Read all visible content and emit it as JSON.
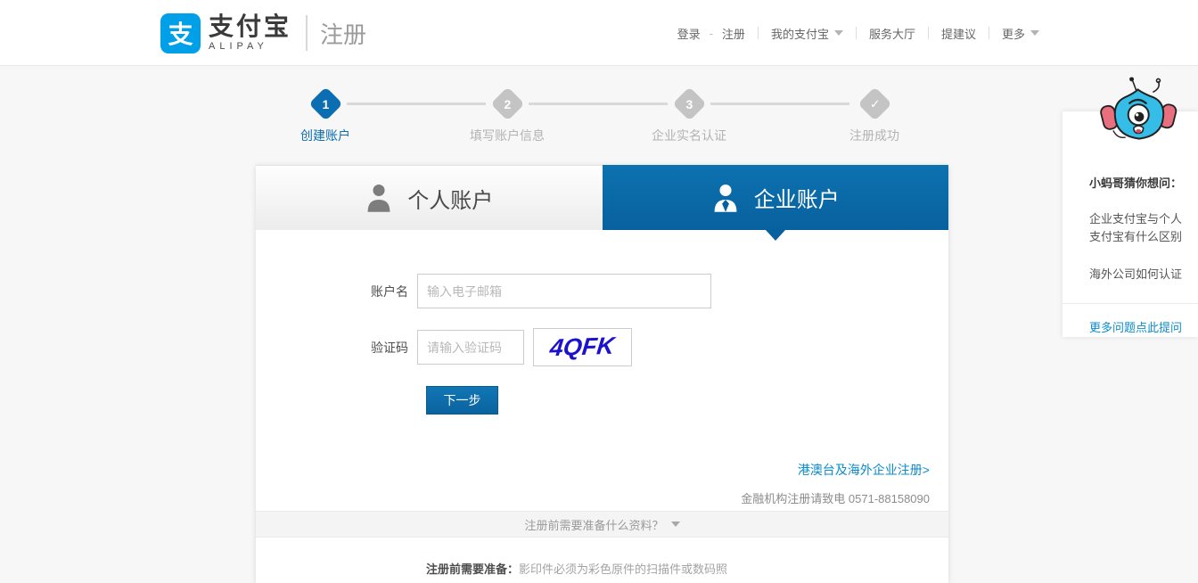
{
  "header": {
    "logo_char": "支",
    "brand_cn": "支付宝",
    "brand_en": "ALIPAY",
    "page_title": "注册",
    "nav_dash": "-",
    "nav": [
      {
        "label": "登录"
      },
      {
        "label": "注册"
      },
      {
        "label": "我的支付宝"
      },
      {
        "label": "服务大厅"
      },
      {
        "label": "提建议"
      },
      {
        "label": "更多"
      }
    ]
  },
  "steps": [
    {
      "num": "1",
      "label": "创建账户"
    },
    {
      "num": "2",
      "label": "填写账户信息"
    },
    {
      "num": "3",
      "label": "企业实名认证"
    },
    {
      "num": "✓",
      "label": "注册成功"
    }
  ],
  "tabs": {
    "personal": "个人账户",
    "enterprise": "企业账户"
  },
  "form": {
    "account_label": "账户名",
    "account_placeholder": "输入电子邮箱",
    "account_value": "",
    "captcha_label": "验证码",
    "captcha_placeholder": "请输入验证码",
    "captcha_value": "",
    "captcha_image_text": "4QFK",
    "next_button": "下一步"
  },
  "links": {
    "overseas": "港澳台及海外企业注册>",
    "finance": "金融机构注册请致电 0571-88158090"
  },
  "prepare": {
    "question": "注册前需要准备什么资料？",
    "title": "注册前需要准备：",
    "desc": "影印件必须为彩色原件的扫描件或数码照"
  },
  "helper": {
    "title": "小蚂哥猜你想问：",
    "questions": [
      "企业支付宝与个人支付宝有什么区别",
      "海外公司如何认证"
    ],
    "more": "更多问题点此提问"
  },
  "colors": {
    "brand_blue": "#00a0e9",
    "active_blue": "#0b6db2",
    "tab_blue_gradient_top": "#0d72b0",
    "tab_blue_gradient_bottom": "#08619e",
    "link_blue": "#0a8ccd",
    "captcha_blue": "#1b12cf",
    "inactive_gray": "#c4c4c4",
    "page_bg": "#f7f7f7"
  }
}
